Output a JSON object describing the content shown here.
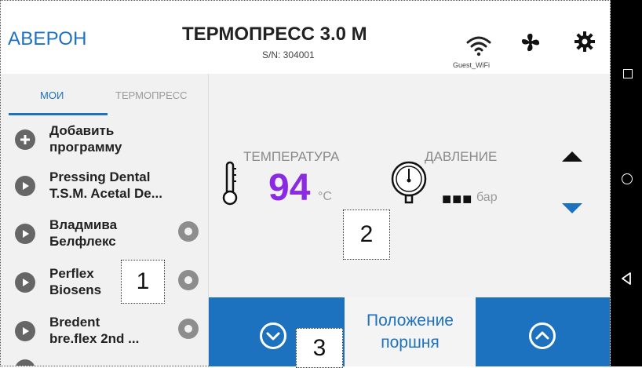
{
  "header": {
    "brand": "АВЕРОН",
    "title": "ТЕРМОПРЕСС 3.0 М",
    "serial": "S/N: 304001",
    "wifi_label": "Guest_WiFi",
    "icons": [
      "wifi-icon",
      "fan-icon",
      "gear-icon"
    ]
  },
  "sidebar": {
    "tabs": [
      {
        "label": "МОИ",
        "active": true
      },
      {
        "label": "ТЕРМОПРЕСС",
        "active": false
      }
    ],
    "items": [
      {
        "line1": "Добавить",
        "line2": "программу",
        "icon": "plus-icon",
        "has_options": false
      },
      {
        "line1": "Pressing Dental",
        "line2": "T.S.M. Acetal De...",
        "icon": "play-icon",
        "has_options": false
      },
      {
        "line1": "Владмива",
        "line2": "Белфлекс",
        "icon": "play-icon",
        "has_options": true
      },
      {
        "line1": "Perflex",
        "line2": "Biosens",
        "icon": "play-icon",
        "has_options": true
      },
      {
        "line1": "Bredent",
        "line2": "bre.flex 2nd ...",
        "icon": "play-icon",
        "has_options": true
      },
      {
        "line1": "",
        "line2": "",
        "icon": "play-icon",
        "has_options": false
      }
    ]
  },
  "readings": {
    "temperature_label": "ТЕМПЕРАТУРА",
    "temperature_value": "94",
    "temperature_unit": "°C",
    "pressure_label": "ДАВЛЕНИЕ",
    "pressure_value": "■■■",
    "pressure_unit": "бар"
  },
  "controls": {
    "piston_line1": "Положение",
    "piston_line2": "поршня"
  },
  "callouts": [
    "1",
    "2",
    "3"
  ],
  "colors": {
    "accent": "#1d72c0",
    "temperature": "#8a2be2",
    "panel_bg": "#f1f1f1"
  }
}
